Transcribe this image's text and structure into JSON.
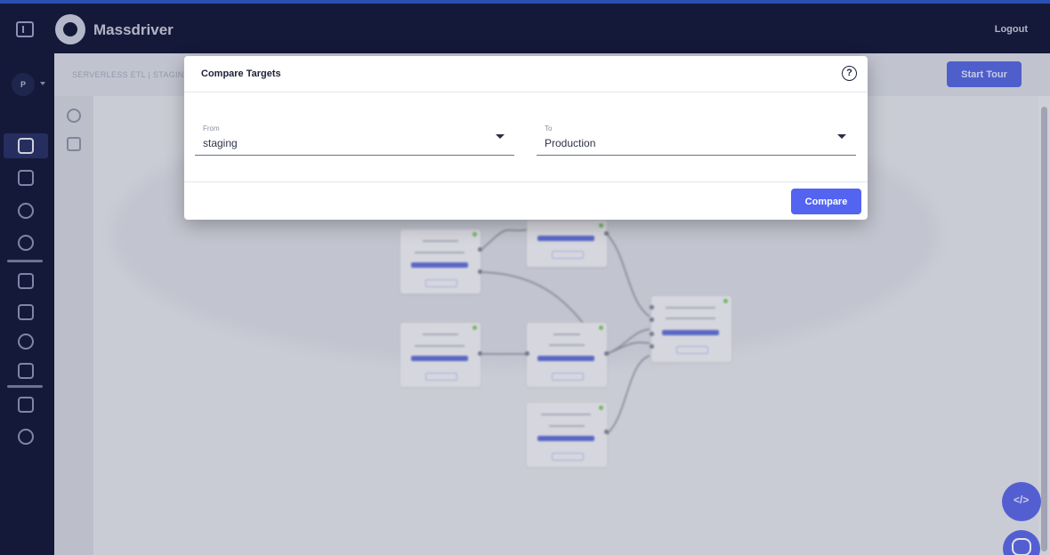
{
  "header": {
    "brand": "Massdriver",
    "logout_label": "Logout",
    "icons": [
      "sidebar-toggle-icon",
      "logo"
    ]
  },
  "leftnav": {
    "avatar_initial": "P",
    "icons": [
      "diagram-icon",
      "packages-icon",
      "globe-icon",
      "gear-icon",
      "lock-icon",
      "org-icon",
      "crosshair-icon",
      "card-icon",
      "book-icon",
      "branch-icon"
    ]
  },
  "breadcrumb": {
    "text": "SERVERLESS ETL  |  STAGING"
  },
  "toolbar": {
    "start_tour_label": "Start Tour"
  },
  "canvas_tools": {
    "zoom_in": "+",
    "zoom_out": "−"
  },
  "dialog": {
    "title": "Compare Targets",
    "help_icon": "?",
    "from": {
      "label": "From",
      "value": "staging"
    },
    "to": {
      "label": "To",
      "value": "Production"
    },
    "compare_label": "Compare"
  },
  "fab": {
    "code_label": "</>"
  },
  "colors": {
    "navbar": "#13193b",
    "accent": "#5264f0",
    "canvas": "#e2e4eb",
    "status_ok": "#7dc868"
  }
}
